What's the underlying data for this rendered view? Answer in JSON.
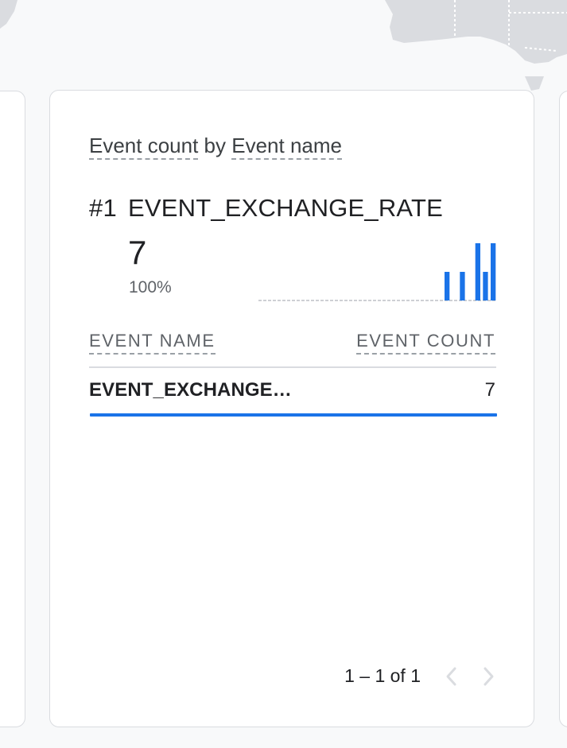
{
  "card": {
    "title_metric": "Event count",
    "title_by": "by",
    "title_dimension": "Event name",
    "top_rank": "#1",
    "top_item": "EVENT_EXCHANGE_RATE",
    "top_value": "7",
    "top_percent": "100%",
    "sparkline_values": [
      0,
      0,
      0,
      0,
      0,
      0,
      0,
      0,
      0,
      0,
      0,
      0,
      0,
      0,
      0,
      0,
      0,
      0,
      0,
      0,
      0,
      0,
      0,
      0,
      1,
      0,
      1,
      0,
      2,
      1,
      2
    ],
    "sparkline_color": "#1a73e8",
    "table": {
      "headers": [
        "EVENT NAME",
        "EVENT COUNT"
      ],
      "rows": [
        {
          "name": "EVENT_EXCHANGE_RATE",
          "count": "7",
          "share": 1.0
        }
      ]
    },
    "pagination": {
      "text": "1 – 1 of 1",
      "prev_icon": "chevron-left-icon",
      "next_icon": "chevron-right-icon"
    }
  },
  "colors": {
    "accent": "#1a73e8",
    "background": "#f8f9fa",
    "card": "#ffffff",
    "map_land": "#dadce0"
  }
}
